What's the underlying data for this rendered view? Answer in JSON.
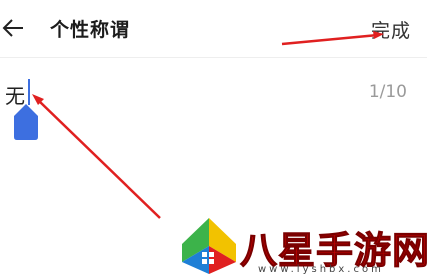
{
  "header": {
    "back_icon": "arrow-left-icon",
    "title": "个性称谓",
    "done_label": "完成"
  },
  "field": {
    "value": "无",
    "counter": "1/10"
  },
  "colors": {
    "caret": "#3d6fe0",
    "annotation_arrow": "#e02020",
    "watermark_red": "#c40000"
  },
  "watermark": {
    "text": "八星手游网",
    "url": "www.lyshbx.com"
  }
}
